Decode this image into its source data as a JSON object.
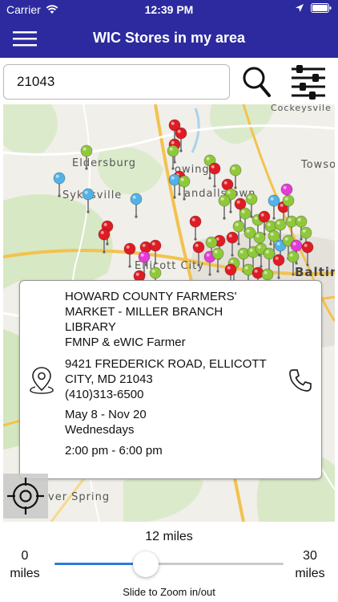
{
  "status_bar": {
    "carrier": "Carrier",
    "time": "12:39 PM"
  },
  "nav": {
    "title": "WIC Stores in my area"
  },
  "search": {
    "value": "21043"
  },
  "map": {
    "labels": {
      "eldersburg": "Eldersburg",
      "sykesville": "Sykesville",
      "ellicott": "Ellicott City",
      "baltimore": "Baltir",
      "towson": "Towso",
      "cockeysville": "Cockeysvile",
      "randallstown": "andallstown",
      "owings": "owing",
      "silver_spring": "ver Spring"
    },
    "pin_colors": {
      "green": "#8fc93a",
      "red": "#e01b24",
      "blue": "#52b2e8",
      "magenta": "#e53bd8"
    }
  },
  "store": {
    "name_lines": [
      "HOWARD COUNTY FARMERS'",
      "MARKET - MILLER BRANCH",
      "LIBRARY",
      "FMNP & eWIC Farmer"
    ],
    "address_lines": [
      "9421 FREDERICK ROAD, ELLICOTT",
      "CITY, MD 21043",
      "(410)313-6500"
    ],
    "hours_lines": [
      "May 8 - Nov 20",
      "Wednesdays",
      "",
      "2:00 pm - 6:00 pm"
    ]
  },
  "slider": {
    "value_label": "12 miles",
    "min_number": "0",
    "min_unit": "miles",
    "max_number": "30",
    "max_unit": "miles",
    "hint": "Slide to Zoom in/out",
    "value": 12,
    "min": 0,
    "max": 30
  },
  "colors": {
    "nav_bg": "#2c2a9e",
    "slider_fill": "#2b7bd9"
  }
}
